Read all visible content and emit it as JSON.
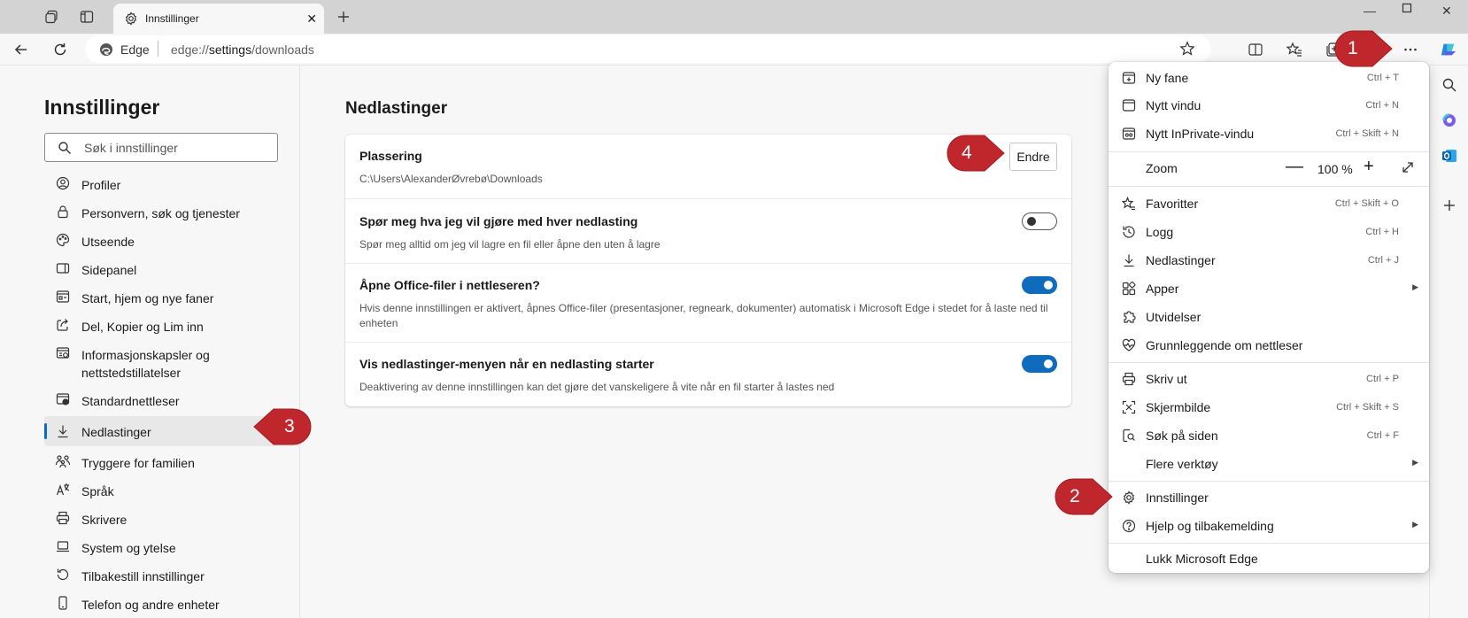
{
  "tab": {
    "title": "Innstillinger"
  },
  "address": {
    "brand": "Edge",
    "url_prefix": "edge://",
    "url_main": "settings",
    "url_suffix": "/downloads"
  },
  "sidebar": {
    "heading": "Innstillinger",
    "search_placeholder": "Søk i innstillinger",
    "items": [
      {
        "label": "Profiler",
        "icon": "profile-icon"
      },
      {
        "label": "Personvern, søk og tjenester",
        "icon": "lock-icon"
      },
      {
        "label": "Utseende",
        "icon": "palette-icon"
      },
      {
        "label": "Sidepanel",
        "icon": "sidepanel-icon"
      },
      {
        "label": "Start, hjem og nye faner",
        "icon": "home-tabs-icon"
      },
      {
        "label": "Del, Kopier og Lim inn",
        "icon": "share-icon"
      },
      {
        "label": "Informasjonskapsler og nettstedstillatelser",
        "icon": "cookies-icon"
      },
      {
        "label": "Standardnettleser",
        "icon": "default-browser-icon"
      },
      {
        "label": "Nedlastinger",
        "icon": "download-icon",
        "active": true
      },
      {
        "label": "Tryggere for familien",
        "icon": "family-icon"
      },
      {
        "label": "Språk",
        "icon": "language-icon"
      },
      {
        "label": "Skrivere",
        "icon": "printer-icon"
      },
      {
        "label": "System og ytelse",
        "icon": "laptop-icon"
      },
      {
        "label": "Tilbakestill innstillinger",
        "icon": "reset-icon"
      },
      {
        "label": "Telefon og andre enheter",
        "icon": "phone-icon"
      }
    ]
  },
  "main": {
    "heading": "Nedlastinger",
    "location": {
      "title": "Plassering",
      "path": "C:\\Users\\AlexanderØvrebø\\Downloads",
      "button": "Endre"
    },
    "ask": {
      "title": "Spør meg hva jeg vil gjøre med hver nedlasting",
      "desc": "Spør meg alltid om jeg vil lagre en fil eller åpne den uten å lagre",
      "enabled": false
    },
    "office": {
      "title": "Åpne Office-filer i nettleseren?",
      "desc": "Hvis denne innstillingen er aktivert, åpnes Office-filer (presentasjoner, regneark, dokumenter) automatisk i Microsoft Edge i stedet for å laste ned til enheten",
      "enabled": true
    },
    "show_menu": {
      "title": "Vis nedlastinger-menyen når en nedlasting starter",
      "desc": "Deaktivering av denne innstillingen kan det gjøre det vanskeligere å vite når en fil starter å lastes ned",
      "enabled": true
    }
  },
  "menu": {
    "new_tab": {
      "label": "Ny fane",
      "shortcut": "Ctrl + T"
    },
    "new_window": {
      "label": "Nytt vindu",
      "shortcut": "Ctrl + N"
    },
    "new_inprivate": {
      "label": "Nytt InPrivate-vindu",
      "shortcut": "Ctrl + Skift + N"
    },
    "zoom": {
      "label": "Zoom",
      "minus": "—",
      "value": "100 %",
      "plus": "+"
    },
    "favorites": {
      "label": "Favoritter",
      "shortcut": "Ctrl + Skift + O"
    },
    "history": {
      "label": "Logg",
      "shortcut": "Ctrl + H"
    },
    "downloads": {
      "label": "Nedlastinger",
      "shortcut": "Ctrl + J"
    },
    "apps": {
      "label": "Apper"
    },
    "extensions": {
      "label": "Utvidelser"
    },
    "browser_essentials": {
      "label": "Grunnleggende om nettleser"
    },
    "print": {
      "label": "Skriv ut",
      "shortcut": "Ctrl + P"
    },
    "screenshot": {
      "label": "Skjermbilde",
      "shortcut": "Ctrl + Skift + S"
    },
    "find": {
      "label": "Søk på siden",
      "shortcut": "Ctrl + F"
    },
    "more_tools": {
      "label": "Flere verktøy"
    },
    "settings": {
      "label": "Innstillinger"
    },
    "help": {
      "label": "Hjelp og tilbakemelding"
    },
    "close": {
      "label": "Lukk Microsoft Edge"
    }
  },
  "callouts": [
    "1",
    "2",
    "3",
    "4"
  ],
  "colors": {
    "accent": "#0f6cbd",
    "callout": "#c0272d",
    "titlebar": "#d3d3d3",
    "page_bg": "#f7f7f7"
  }
}
